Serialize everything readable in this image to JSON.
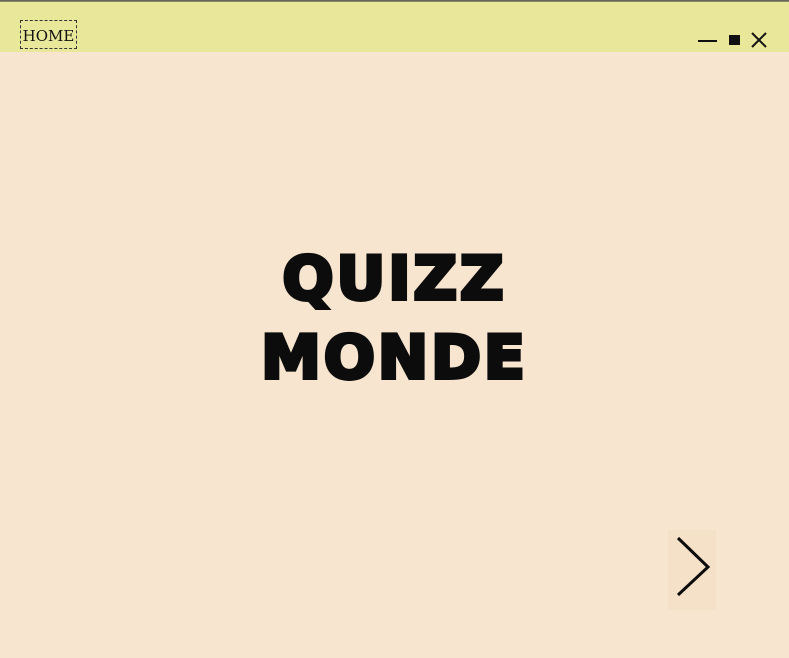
{
  "window": {
    "home_label": "HOME",
    "controls": {
      "minimize_icon": "minimize-icon",
      "maximize_icon": "maximize-icon",
      "close_icon": "close-icon"
    }
  },
  "main": {
    "title_line1": "QUIZZ",
    "title_line2": "MONDE"
  },
  "navigation": {
    "next_icon": "chevron-right-icon"
  },
  "colors": {
    "background": "#f7e5cf",
    "titlebar": "#e9e79a",
    "text": "#0c0c0c"
  }
}
